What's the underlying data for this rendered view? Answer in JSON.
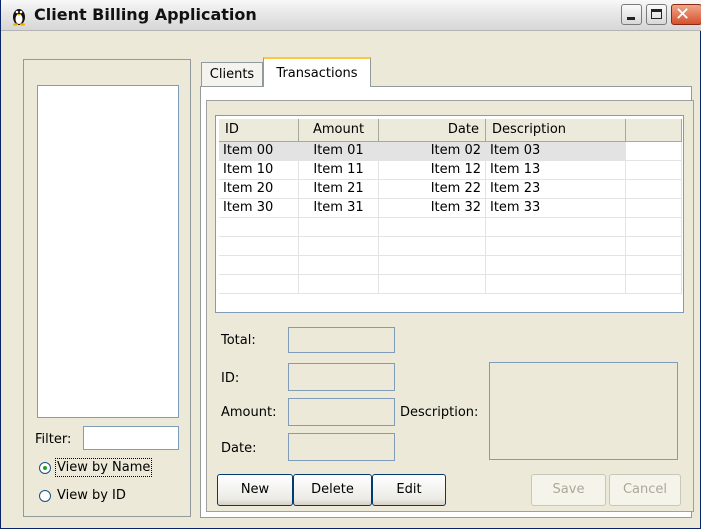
{
  "window": {
    "title": "Client Billing Application"
  },
  "left_panel": {
    "filter_label": "Filter:",
    "filter_value": "",
    "radio_view_by_name": "View by Name",
    "radio_view_by_id": "View by ID",
    "selected_view": "View by Name"
  },
  "tabs": [
    {
      "label": "Clients",
      "active": false
    },
    {
      "label": "Transactions",
      "active": true
    }
  ],
  "table": {
    "columns": [
      "ID",
      "Amount",
      "Date",
      "Description",
      ""
    ],
    "rows": [
      [
        "Item 00",
        "Item 01",
        "Item 02",
        "Item 03",
        ""
      ],
      [
        "Item 10",
        "Item 11",
        "Item 12",
        "Item 13",
        ""
      ],
      [
        "Item 20",
        "Item 21",
        "Item 22",
        "Item 23",
        ""
      ],
      [
        "Item 30",
        "Item 31",
        "Item 32",
        "Item 33",
        ""
      ],
      [
        "",
        "",
        "",
        "",
        ""
      ],
      [
        "",
        "",
        "",
        "",
        ""
      ],
      [
        "",
        "",
        "",
        "",
        ""
      ],
      [
        "",
        "",
        "",
        "",
        ""
      ]
    ],
    "selected_row": 0
  },
  "form": {
    "total_label": "Total:",
    "id_label": "ID:",
    "amount_label": "Amount:",
    "date_label": "Date:",
    "description_label": "Description:",
    "total_value": "",
    "id_value": "",
    "amount_value": "",
    "date_value": "",
    "description_value": ""
  },
  "buttons": {
    "new": "New",
    "delete": "Delete",
    "edit": "Edit",
    "save": "Save",
    "cancel": "Cancel"
  },
  "icons": {
    "app": "penguin-icon",
    "minimize": "minimize-icon",
    "maximize": "maximize-icon",
    "close": "close-icon"
  },
  "colors": {
    "selection": "#e3e3e3",
    "active_tab_accent": "#ffc83c",
    "close_button": "#d6512f"
  }
}
